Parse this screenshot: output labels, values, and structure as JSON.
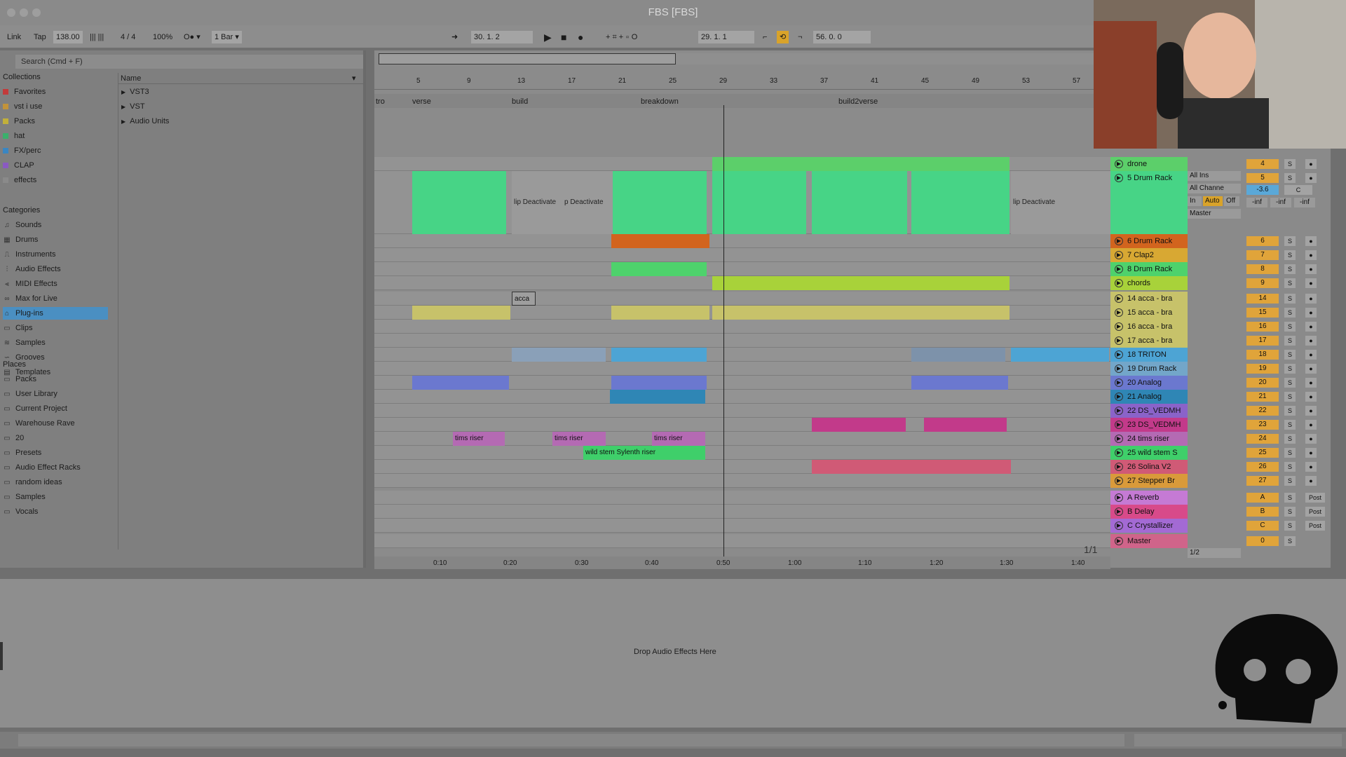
{
  "window": {
    "title": "FBS  [FBS]"
  },
  "control_bar": {
    "link": "Link",
    "tap": "Tap",
    "tempo": "138.00",
    "signature": "4 / 4",
    "zoom": "100%",
    "quantize": "1 Bar",
    "arrangement_position": "30.  1.  2",
    "loop_start": "29.  1.  1",
    "loop_length": "56.  0.  0"
  },
  "browser": {
    "search_placeholder": "Search (Cmd + F)",
    "name_header": "Name",
    "collections_header": "Collections",
    "collections": [
      {
        "label": "Favorites",
        "color": "#c23a3a"
      },
      {
        "label": "vst i use",
        "color": "#c2933a"
      },
      {
        "label": "Packs",
        "color": "#c2b03a"
      },
      {
        "label": "hat",
        "color": "#3ab06c"
      },
      {
        "label": "FX/perc",
        "color": "#3a86c2"
      },
      {
        "label": "CLAP",
        "color": "#8a5ac2"
      },
      {
        "label": "effects",
        "color": "#8a8a8a"
      }
    ],
    "categories_header": "Categories",
    "categories": [
      "Sounds",
      "Drums",
      "Instruments",
      "Audio Effects",
      "MIDI Effects",
      "Max for Live",
      "Plug-ins",
      "Clips",
      "Samples",
      "Grooves",
      "Templates"
    ],
    "selected_category": "Plug-ins",
    "places_header": "Places",
    "places": [
      "Packs",
      "User Library",
      "Current Project",
      "Warehouse Rave",
      "20",
      "Presets",
      "Audio Effect Racks",
      "random ideas",
      "Samples",
      "Vocals"
    ],
    "files": [
      "VST3",
      "VST",
      "Audio Units"
    ]
  },
  "arrangement": {
    "bar_numbers": [
      "5",
      "9",
      "13",
      "17",
      "21",
      "25",
      "29",
      "33",
      "37",
      "41",
      "45",
      "49",
      "53",
      "57"
    ],
    "locators": [
      "tro",
      "verse",
      "build",
      "breakdown",
      "build2verse"
    ],
    "time_ticks": [
      "0:10",
      "0:20",
      "0:30",
      "0:40",
      "0:50",
      "1:00",
      "1:10",
      "1:20",
      "1:30",
      "1:40"
    ],
    "clip_labels": {
      "deactivated": "lip Deactivate",
      "deactivated2": "p Deactivate",
      "acca": "acca",
      "tims_riser": "tims riser",
      "wild_stem": "wild stem Sylenth riser"
    },
    "page_indicator": "1/1"
  },
  "tracks": [
    {
      "name": "drone",
      "number": "4",
      "color": "#5ccf6a"
    },
    {
      "name": "5 Drum Rack",
      "number": "5",
      "color": "#47d486"
    },
    {
      "name": "6 Drum Rack",
      "number": "6",
      "color": "#d2641e"
    },
    {
      "name": "7 Clap2",
      "number": "7",
      "color": "#d8a833"
    },
    {
      "name": "8 Drum Rack",
      "number": "8",
      "color": "#4ed26c"
    },
    {
      "name": "chords",
      "number": "9",
      "color": "#a8d23a"
    },
    {
      "name": "14 acca - bra",
      "number": "14",
      "color": "#c7c26a"
    },
    {
      "name": "15 acca - bra",
      "number": "15",
      "color": "#c7c26a"
    },
    {
      "name": "16 acca - bra",
      "number": "16",
      "color": "#c7c26a"
    },
    {
      "name": "17 acca - bra",
      "number": "17",
      "color": "#c7c26a"
    },
    {
      "name": "18 TRITON",
      "number": "18",
      "color": "#4da4d4"
    },
    {
      "name": "19 Drum Rack",
      "number": "19",
      "color": "#73a6c9"
    },
    {
      "name": "20 Analog",
      "number": "20",
      "color": "#6b78cf"
    },
    {
      "name": "21 Analog",
      "number": "21",
      "color": "#2f86b5"
    },
    {
      "name": "22 DS_VEDMH",
      "number": "22",
      "color": "#8a63c9"
    },
    {
      "name": "23 DS_VEDMH",
      "number": "23",
      "color": "#c23a8a"
    },
    {
      "name": "24 tims riser",
      "number": "24",
      "color": "#b46ab3"
    },
    {
      "name": "25 wild stem S",
      "number": "25",
      "color": "#3fcf6a"
    },
    {
      "name": "26 Solina V2",
      "number": "26",
      "color": "#d05a76"
    },
    {
      "name": "27 Stepper Br",
      "number": "27",
      "color": "#d99a3a"
    },
    {
      "name": "A Reverb",
      "number": "A",
      "color": "#c57ad4"
    },
    {
      "name": "B Delay",
      "number": "B",
      "color": "#d84a8a"
    },
    {
      "name": "C Crystallizer",
      "number": "C",
      "color": "#a36ad4"
    },
    {
      "name": "Master",
      "number": "0",
      "color": "#d0648a"
    }
  ],
  "mixer": {
    "all_ins": "All Ins",
    "all_channels": "All Channe",
    "in": "In",
    "auto": "Auto",
    "off": "Off",
    "master_out": "Master",
    "volume": "-3.6",
    "pan": "C",
    "inf": "-inf",
    "solo": "S",
    "post": "Post",
    "master_split": "1/2"
  },
  "detail": {
    "drop_hint": "Drop Audio Effects Here"
  }
}
